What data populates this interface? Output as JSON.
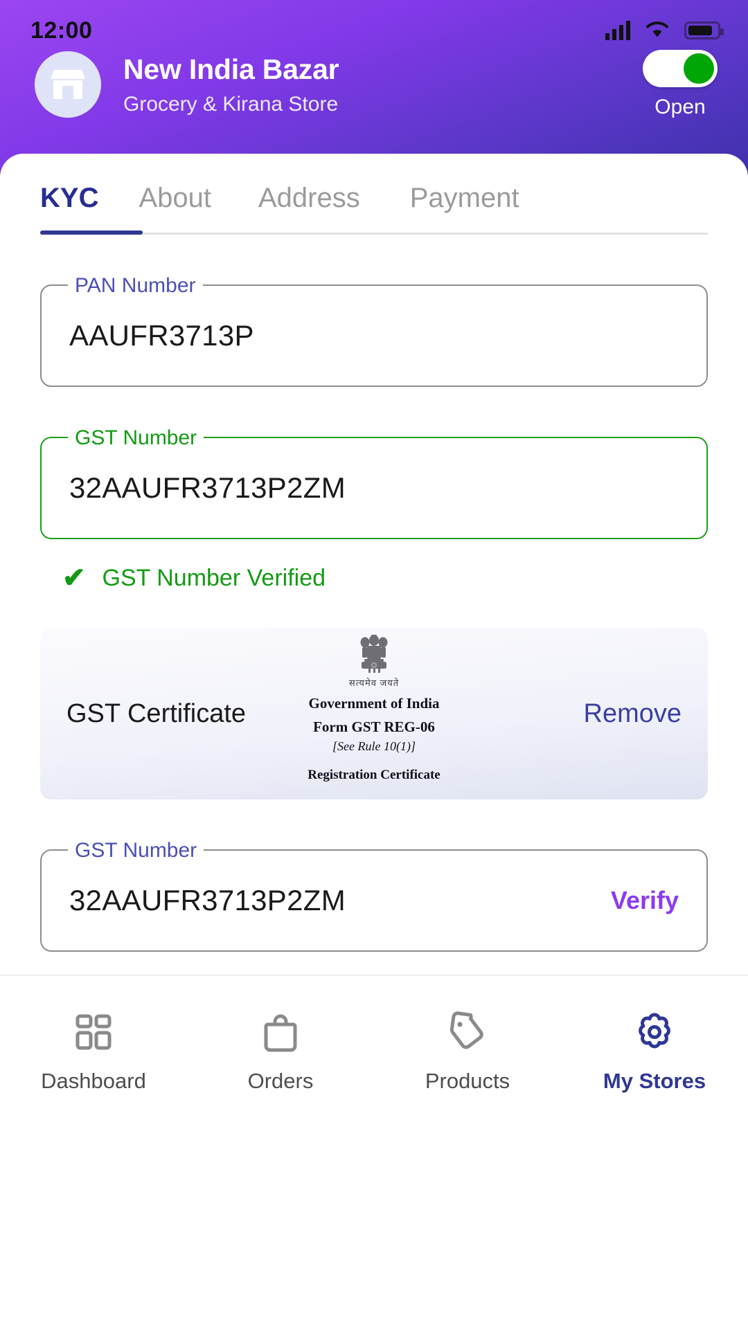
{
  "status_bar": {
    "time": "12:00",
    "signal_icon": "cellular-signal-icon",
    "wifi_icon": "wifi-icon",
    "battery_icon": "battery-icon"
  },
  "header": {
    "store_icon": "storefront-icon",
    "store_name": "New India Bazar",
    "store_subtitle": "Grocery & Kirana Store",
    "toggle_label": "Open",
    "toggle_state": "on",
    "toggle_on_color": "#00a606",
    "gradient_from": "#9b46f0",
    "gradient_to": "#3c30a8"
  },
  "tabs": {
    "items": [
      {
        "label": "KYC",
        "active": true
      },
      {
        "label": "About",
        "active": false
      },
      {
        "label": "Address",
        "active": false
      },
      {
        "label": "Payment",
        "active": false
      }
    ],
    "active_color": "#262d92",
    "inactive_color": "#9b9b9b"
  },
  "form": {
    "pan_field": {
      "label": "PAN Number",
      "value": "AAUFR3713P",
      "label_color": "#4b4fb4",
      "border_color": "#8d8d8d"
    },
    "gst_field_verified": {
      "label": "GST Number",
      "value": "32AAUFR3713P2ZM",
      "label_color": "#129b12",
      "border_color": "#1aa01a"
    },
    "verified_status": {
      "icon": "check-icon",
      "text": "GST Number Verified",
      "color": "#139b13"
    },
    "certificate_card": {
      "name": "GST Certificate",
      "remove_label": "Remove",
      "remove_color": "#3a3fa0",
      "preview": {
        "emblem_icon": "india-state-emblem-icon",
        "motto": "सत्यमेव जयते",
        "line1": "Government of India",
        "line2": "Form GST REG-06",
        "rule": "[See Rule 10(1)]",
        "title": "Registration Certificate"
      }
    },
    "gst_field_entry": {
      "label": "GST Number",
      "value": "32AAUFR3713P2ZM",
      "action_label": "Verify",
      "action_color": "#8b3bf0",
      "label_color": "#4b4fb4"
    }
  },
  "bottom_nav": {
    "items": [
      {
        "label": "Dashboard",
        "icon": "grid-dashboard-icon",
        "active": false
      },
      {
        "label": "Orders",
        "icon": "shopping-bag-icon",
        "active": false
      },
      {
        "label": "Products",
        "icon": "price-tag-icon",
        "active": false
      },
      {
        "label": "My Stores",
        "icon": "gear-icon",
        "active": true
      }
    ],
    "active_color": "#2f3794",
    "inactive_color": "#8a8a8a"
  }
}
